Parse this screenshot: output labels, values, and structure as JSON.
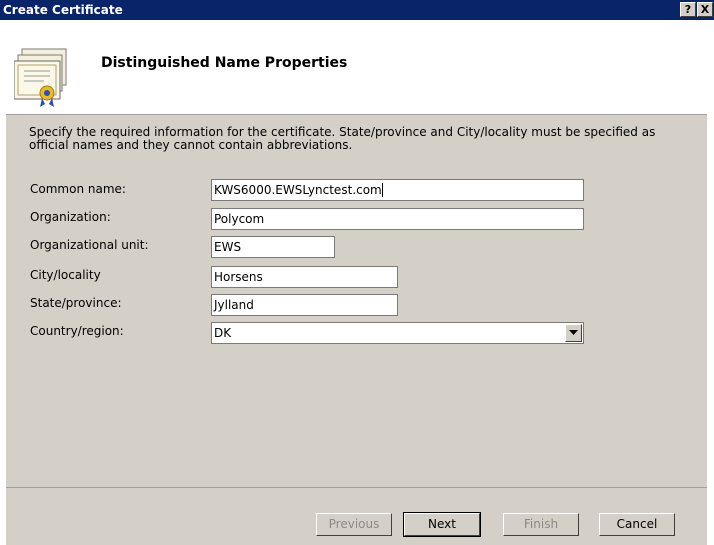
{
  "window": {
    "title": "Create Certificate",
    "help_label": "?",
    "close_label": "X"
  },
  "header": {
    "title": "Distinguished Name Properties",
    "icon": "certificate-icon"
  },
  "description": "Specify the required information for the certificate. State/province and City/locality must be specified as official names and they cannot contain abbreviations.",
  "fields": {
    "common_name": {
      "label": "Common name:",
      "value": "KWS6000.EWSLynctest.com"
    },
    "organization": {
      "label": "Organization:",
      "value": "Polycom"
    },
    "organizational_unit": {
      "label": "Organizational unit:",
      "value": "EWS"
    },
    "city": {
      "label": "City/locality",
      "value": "Horsens"
    },
    "state": {
      "label": "State/province:",
      "value": "Jylland"
    },
    "country": {
      "label": "Country/region:",
      "value": "DK"
    }
  },
  "buttons": {
    "previous": "Previous",
    "next": "Next",
    "finish": "Finish",
    "cancel": "Cancel"
  },
  "colors": {
    "titlebar": "#0a246a",
    "panel": "#d4d0c8",
    "disabled_text": "#8a8a8a"
  }
}
